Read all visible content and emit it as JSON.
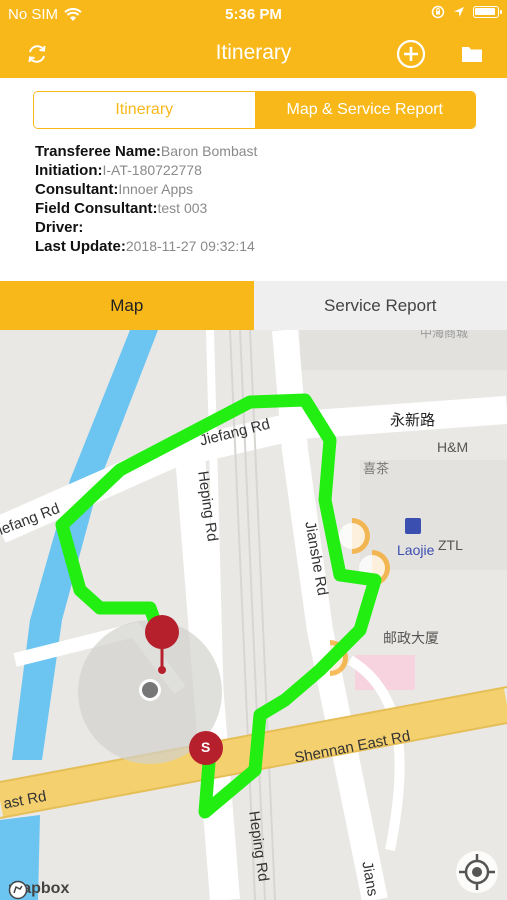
{
  "status_bar": {
    "carrier": "No SIM",
    "time": "5:36 PM",
    "battery_level": 0.85
  },
  "nav": {
    "title": "Itinerary",
    "left_icon": "refresh-icon",
    "right_icons": [
      "add-circle-icon",
      "folder-icon"
    ]
  },
  "segmented": {
    "items": [
      {
        "label": "Itinerary",
        "selected": false
      },
      {
        "label": "Map & Service Report",
        "selected": true
      }
    ]
  },
  "info": {
    "transferee_label": "Transferee Name:",
    "transferee_value": "Baron Bombast",
    "initiation_label": "Initiation:",
    "initiation_value": "I-AT-180722778",
    "consultant_label": "Consultant:",
    "consultant_value": "Innoer Apps",
    "field_consultant_label": "Field Consultant:",
    "field_consultant_value": "test 003",
    "driver_label": "Driver:",
    "driver_value": "",
    "last_update_label": "Last Update:",
    "last_update_value": "2018-11-27 09:32:14"
  },
  "tabs": {
    "items": [
      {
        "label": "Map",
        "selected": true
      },
      {
        "label": "Service Report",
        "selected": false
      }
    ]
  },
  "map": {
    "labels": {
      "jiefang_rd": "Jiefang Rd",
      "jiefang_rd_left": "iefang Rd",
      "heping_rd": "Heping Rd",
      "heping_rd_lower": "Heping Rd",
      "jianshe_rd": "Jianshe Rd",
      "jianshe_rd_lower": "Jians",
      "shennan_east_rd": "Shennan East Rd",
      "shennan_left": "ast Rd",
      "yongxin_rd": "永新路",
      "hm": "H&M",
      "xicha": "喜茶",
      "laojie": "Laojie",
      "ztl": "ZTL",
      "post_office": "邮政大厦",
      "top_chinese": "中海商城",
      "start_marker": "S"
    },
    "logo": "mapbox",
    "colors": {
      "route": "#22EE11",
      "marker": "#B5202C",
      "accent": "#F8B81A",
      "poi": "#F5A623"
    }
  }
}
